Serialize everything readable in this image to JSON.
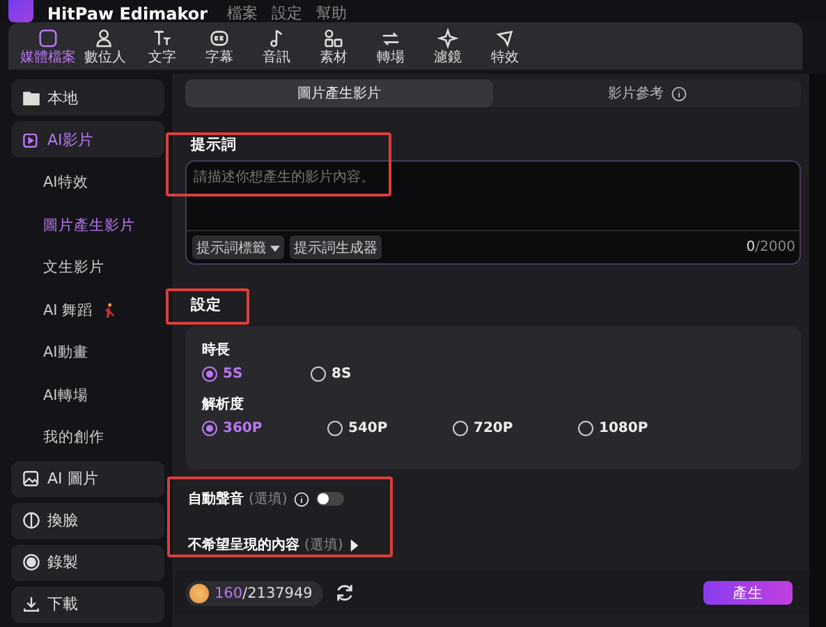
{
  "titlebar": {
    "app_name": "HitPaw Edimakor",
    "menu": [
      "檔案",
      "設定",
      "幫助"
    ]
  },
  "toolbar": [
    {
      "label": "媒體檔案",
      "selected": true
    },
    {
      "label": "數位人",
      "selected": false
    },
    {
      "label": "文字",
      "selected": false
    },
    {
      "label": "字幕",
      "selected": false
    },
    {
      "label": "音訊",
      "selected": false
    },
    {
      "label": "素材",
      "selected": false
    },
    {
      "label": "轉場",
      "selected": false
    },
    {
      "label": "濾鏡",
      "selected": false
    },
    {
      "label": "特效",
      "selected": false
    }
  ],
  "sidebar": [
    {
      "label": "本地",
      "selected": false
    },
    {
      "label": "AI影片",
      "selected": true,
      "children": [
        {
          "label": "AI特效",
          "selected": false
        },
        {
          "label": "圖片產生影片",
          "selected": true
        },
        {
          "label": "文生影片",
          "selected": false
        },
        {
          "label": "AI 舞蹈",
          "selected": false
        },
        {
          "label": "AI動畫",
          "selected": false
        },
        {
          "label": "AI轉場",
          "selected": false
        },
        {
          "label": "我的創作",
          "selected": false
        }
      ]
    },
    {
      "label": "AI 圖片",
      "selected": false
    },
    {
      "label": "換臉",
      "selected": false
    },
    {
      "label": "錄製",
      "selected": false
    },
    {
      "label": "下載",
      "selected": false
    }
  ],
  "mode_tabs": [
    {
      "label": "圖片產生影片",
      "selected": true
    },
    {
      "label": "影片參考",
      "selected": false
    }
  ],
  "prompt": {
    "label": "提示詞",
    "placeholder": "請描述你想產生的影片內容。",
    "tag_button": "提示詞標籤",
    "generator_button": "提示詞生成器",
    "count_used": "0",
    "count_max": "/2000"
  },
  "settings": {
    "label": "設定",
    "groups": [
      {
        "label": "時長",
        "options": [
          {
            "label": "5S",
            "selected": true
          },
          {
            "label": "8S",
            "selected": false
          }
        ]
      },
      {
        "label": "解析度",
        "options": [
          {
            "label": "360P",
            "selected": true
          },
          {
            "label": "540P",
            "selected": false
          },
          {
            "label": "720P",
            "selected": false
          },
          {
            "label": "1080P",
            "selected": false
          }
        ]
      }
    ]
  },
  "auto_sound": {
    "label": "自動聲音",
    "optional": "(選填)",
    "on": false
  },
  "negative": {
    "label": "不希望呈現的內容",
    "optional": "(選填)"
  },
  "footer": {
    "credits_used": "160",
    "credits_total": "/2137949",
    "generate": "產生"
  }
}
